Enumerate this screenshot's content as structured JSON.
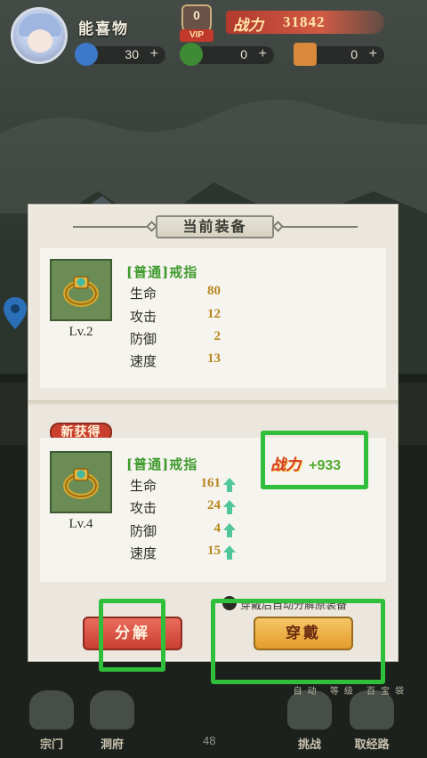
{
  "player": {
    "name": "能喜物",
    "vip_level": "0",
    "vip_tag": "VIP"
  },
  "power": {
    "label": "战力",
    "value": "31842"
  },
  "resources": [
    {
      "icon": "blue-crystal-icon",
      "value": "30"
    },
    {
      "icon": "green-jade-icon",
      "value": "0"
    },
    {
      "icon": "scroll-icon",
      "value": "0"
    }
  ],
  "modal": {
    "title": "当前装备",
    "current": {
      "name": "[普通]戒指",
      "level": "Lv.2",
      "stats": [
        {
          "label": "生命",
          "value": "80"
        },
        {
          "label": "攻击",
          "value": "12"
        },
        {
          "label": "防御",
          "value": "2"
        },
        {
          "label": "速度",
          "value": "13"
        }
      ]
    },
    "new_badge": "新获得",
    "new": {
      "name": "[普通]戒指",
      "level": "Lv.4",
      "stats": [
        {
          "label": "生命",
          "value": "161"
        },
        {
          "label": "攻击",
          "value": "24"
        },
        {
          "label": "防御",
          "value": "4"
        },
        {
          "label": "速度",
          "value": "15"
        }
      ]
    },
    "power_label": "战力",
    "power_increase": "+933",
    "auto_checkbox": "穿戴后自动分解原装备",
    "decompose_button": "分解",
    "equip_button": "穿戴"
  },
  "bottom": {
    "level_number": "48",
    "nav": [
      "宗门",
      "洞府",
      "挑战",
      "取经路"
    ],
    "side_tabs": "自动 等级 百宝袋"
  },
  "colors": {
    "highlight": "#2fbf3a",
    "accent_red": "#c9412e",
    "accent_gold": "#e49b2c",
    "item_green": "#3f9a2d"
  }
}
